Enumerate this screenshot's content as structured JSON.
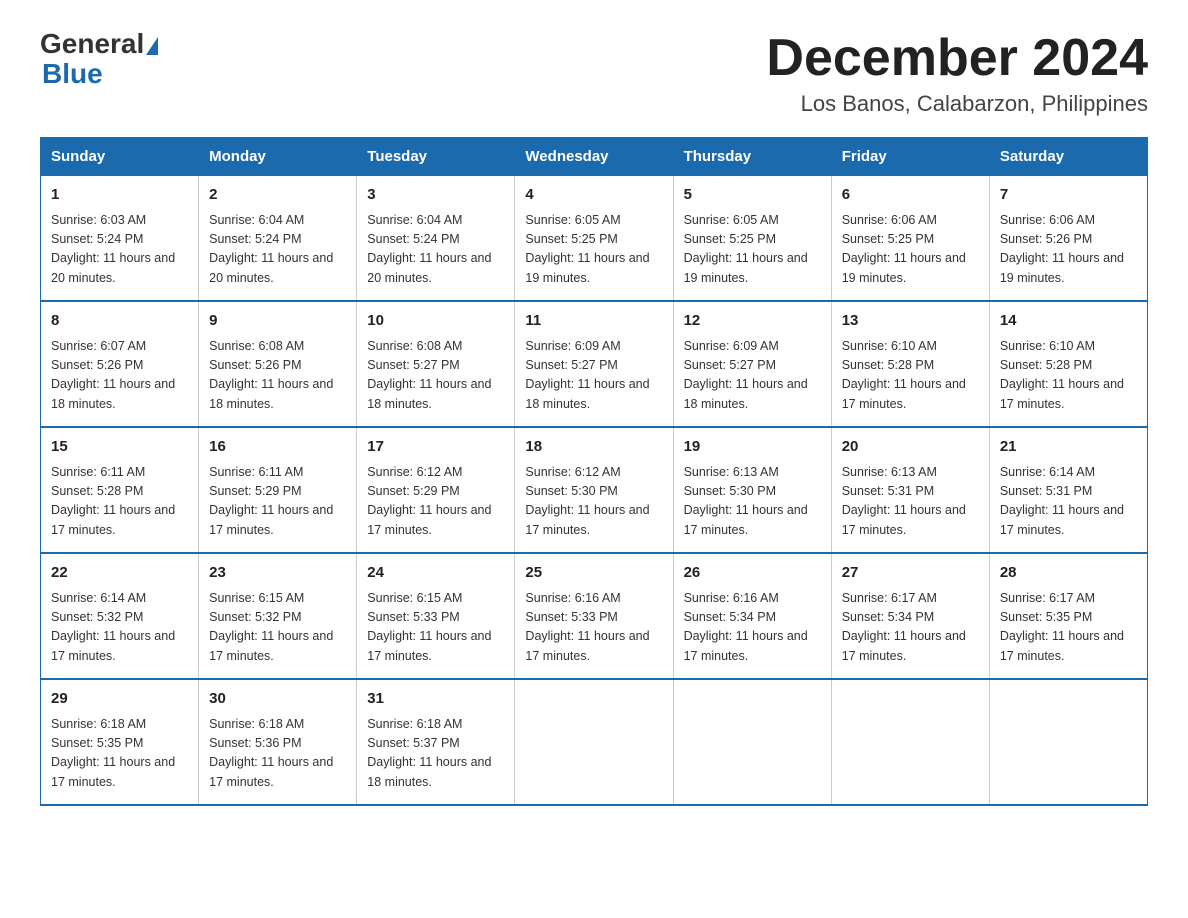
{
  "header": {
    "logo_general": "General",
    "logo_blue": "Blue",
    "title": "December 2024",
    "location": "Los Banos, Calabarzon, Philippines"
  },
  "days_of_week": [
    "Sunday",
    "Monday",
    "Tuesday",
    "Wednesday",
    "Thursday",
    "Friday",
    "Saturday"
  ],
  "weeks": [
    [
      {
        "day": "1",
        "sunrise": "6:03 AM",
        "sunset": "5:24 PM",
        "daylight": "11 hours and 20 minutes."
      },
      {
        "day": "2",
        "sunrise": "6:04 AM",
        "sunset": "5:24 PM",
        "daylight": "11 hours and 20 minutes."
      },
      {
        "day": "3",
        "sunrise": "6:04 AM",
        "sunset": "5:24 PM",
        "daylight": "11 hours and 20 minutes."
      },
      {
        "day": "4",
        "sunrise": "6:05 AM",
        "sunset": "5:25 PM",
        "daylight": "11 hours and 19 minutes."
      },
      {
        "day": "5",
        "sunrise": "6:05 AM",
        "sunset": "5:25 PM",
        "daylight": "11 hours and 19 minutes."
      },
      {
        "day": "6",
        "sunrise": "6:06 AM",
        "sunset": "5:25 PM",
        "daylight": "11 hours and 19 minutes."
      },
      {
        "day": "7",
        "sunrise": "6:06 AM",
        "sunset": "5:26 PM",
        "daylight": "11 hours and 19 minutes."
      }
    ],
    [
      {
        "day": "8",
        "sunrise": "6:07 AM",
        "sunset": "5:26 PM",
        "daylight": "11 hours and 18 minutes."
      },
      {
        "day": "9",
        "sunrise": "6:08 AM",
        "sunset": "5:26 PM",
        "daylight": "11 hours and 18 minutes."
      },
      {
        "day": "10",
        "sunrise": "6:08 AM",
        "sunset": "5:27 PM",
        "daylight": "11 hours and 18 minutes."
      },
      {
        "day": "11",
        "sunrise": "6:09 AM",
        "sunset": "5:27 PM",
        "daylight": "11 hours and 18 minutes."
      },
      {
        "day": "12",
        "sunrise": "6:09 AM",
        "sunset": "5:27 PM",
        "daylight": "11 hours and 18 minutes."
      },
      {
        "day": "13",
        "sunrise": "6:10 AM",
        "sunset": "5:28 PM",
        "daylight": "11 hours and 17 minutes."
      },
      {
        "day": "14",
        "sunrise": "6:10 AM",
        "sunset": "5:28 PM",
        "daylight": "11 hours and 17 minutes."
      }
    ],
    [
      {
        "day": "15",
        "sunrise": "6:11 AM",
        "sunset": "5:28 PM",
        "daylight": "11 hours and 17 minutes."
      },
      {
        "day": "16",
        "sunrise": "6:11 AM",
        "sunset": "5:29 PM",
        "daylight": "11 hours and 17 minutes."
      },
      {
        "day": "17",
        "sunrise": "6:12 AM",
        "sunset": "5:29 PM",
        "daylight": "11 hours and 17 minutes."
      },
      {
        "day": "18",
        "sunrise": "6:12 AM",
        "sunset": "5:30 PM",
        "daylight": "11 hours and 17 minutes."
      },
      {
        "day": "19",
        "sunrise": "6:13 AM",
        "sunset": "5:30 PM",
        "daylight": "11 hours and 17 minutes."
      },
      {
        "day": "20",
        "sunrise": "6:13 AM",
        "sunset": "5:31 PM",
        "daylight": "11 hours and 17 minutes."
      },
      {
        "day": "21",
        "sunrise": "6:14 AM",
        "sunset": "5:31 PM",
        "daylight": "11 hours and 17 minutes."
      }
    ],
    [
      {
        "day": "22",
        "sunrise": "6:14 AM",
        "sunset": "5:32 PM",
        "daylight": "11 hours and 17 minutes."
      },
      {
        "day": "23",
        "sunrise": "6:15 AM",
        "sunset": "5:32 PM",
        "daylight": "11 hours and 17 minutes."
      },
      {
        "day": "24",
        "sunrise": "6:15 AM",
        "sunset": "5:33 PM",
        "daylight": "11 hours and 17 minutes."
      },
      {
        "day": "25",
        "sunrise": "6:16 AM",
        "sunset": "5:33 PM",
        "daylight": "11 hours and 17 minutes."
      },
      {
        "day": "26",
        "sunrise": "6:16 AM",
        "sunset": "5:34 PM",
        "daylight": "11 hours and 17 minutes."
      },
      {
        "day": "27",
        "sunrise": "6:17 AM",
        "sunset": "5:34 PM",
        "daylight": "11 hours and 17 minutes."
      },
      {
        "day": "28",
        "sunrise": "6:17 AM",
        "sunset": "5:35 PM",
        "daylight": "11 hours and 17 minutes."
      }
    ],
    [
      {
        "day": "29",
        "sunrise": "6:18 AM",
        "sunset": "5:35 PM",
        "daylight": "11 hours and 17 minutes."
      },
      {
        "day": "30",
        "sunrise": "6:18 AM",
        "sunset": "5:36 PM",
        "daylight": "11 hours and 17 minutes."
      },
      {
        "day": "31",
        "sunrise": "6:18 AM",
        "sunset": "5:37 PM",
        "daylight": "11 hours and 18 minutes."
      },
      null,
      null,
      null,
      null
    ]
  ]
}
